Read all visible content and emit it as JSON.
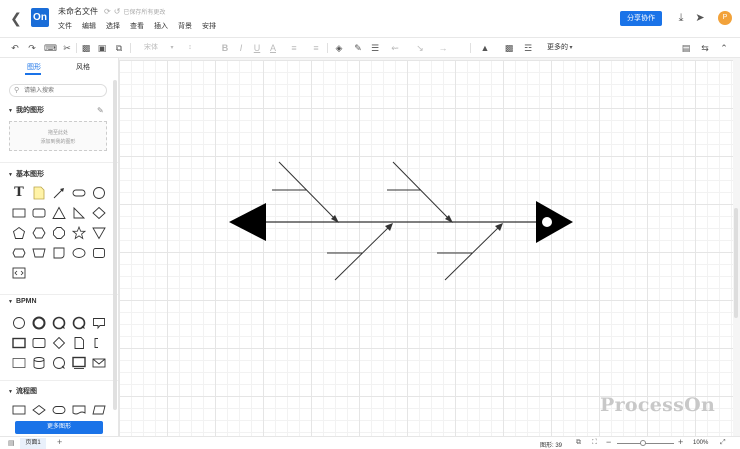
{
  "header": {
    "back_icon": "chevron-left-icon",
    "logo_text": "On",
    "doc_title": "未命名文件",
    "save_status": "已保存所有更改",
    "menu": [
      "文件",
      "编辑",
      "选择",
      "查看",
      "插入",
      "背景",
      "安排"
    ],
    "share_label": "分享协作",
    "avatar_letter": "P",
    "brand_color": "#1a73e8"
  },
  "toolbar": {
    "font_label": "宋体",
    "more_label": "更多的"
  },
  "sidebar": {
    "tabs": [
      "图形",
      "风格"
    ],
    "search_placeholder": "请输入搜索",
    "my_shapes": {
      "title": "我的图形",
      "hint_line1": "拖至此处",
      "hint_line2": "添加到我的图形"
    },
    "basic_title": "基本图形",
    "bpmn_title": "BPMN",
    "flow_title": "流程图",
    "more_shapes_label": "更多图形"
  },
  "canvas": {
    "watermark": "ProcessOn"
  },
  "status": {
    "page_label": "页面1",
    "shape_count": "图形: 39",
    "zoom_level": "100%",
    "zoom_fraction": 0.45
  }
}
